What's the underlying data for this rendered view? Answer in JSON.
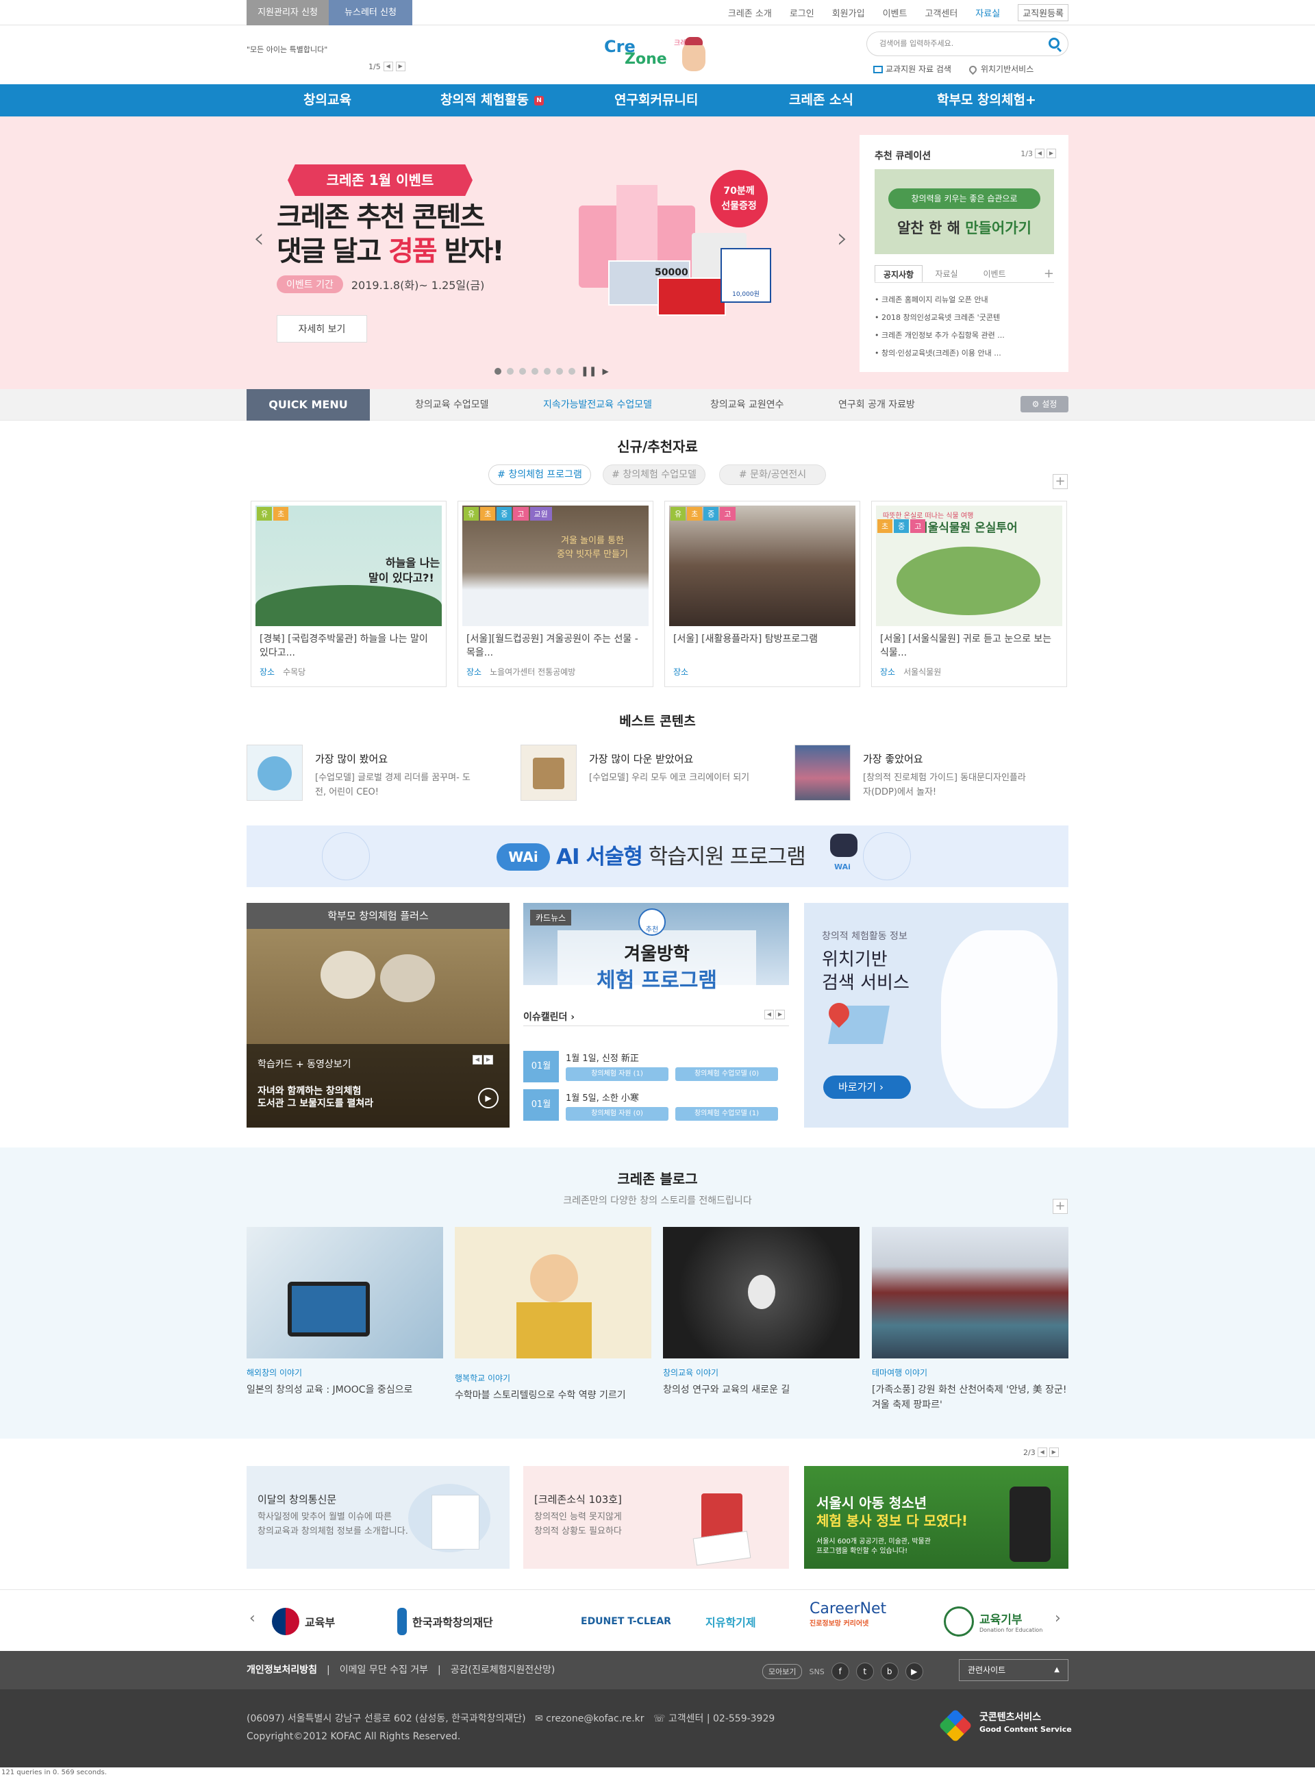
{
  "util": {
    "tab1": "지원관리자 신청",
    "tab2": "뉴스레터 신청",
    "links": [
      "크레존 소개",
      "로그인",
      "회원가입",
      "이벤트",
      "고객센터",
      "자료실",
      "교직원등록"
    ]
  },
  "header": {
    "slogan": "\"모든 아이는 특별합니다\"",
    "slogan_page": "1/5",
    "logo_text_1": "Cre",
    "logo_text_2": "Zone",
    "logo_sub": "크레존",
    "search_placeholder": "검색어를 입력하주세요.",
    "sub_link_1": "교과지원 자료 검색",
    "sub_link_2": "위치기반서비스"
  },
  "gnb": [
    "창의교육",
    "창의적 체험활동",
    "연구회커뮤니티",
    "크레존 소식",
    "학부모 창의체험+"
  ],
  "gnb_new": "N",
  "hero": {
    "badge": "크레존 1월 이벤트",
    "line1": "크레존 추천 콘텐츠",
    "line2a": "댓글 달고 ",
    "line2b": "경품",
    "line2c": " 받자!",
    "period_label": "이벤트 기간",
    "period": "2019.1.8(화)~ 1.25일(금)",
    "more": "자세히 보기",
    "gift_badge": "70분께\n선물증정",
    "card_amount": "50000",
    "card_amount2": "10,000원"
  },
  "curation": {
    "title": "추천 큐레이션",
    "page": "1/3",
    "img_line1": "창의력을 키우는 좋은 습관으로",
    "img_line2a": "알찬 한 해 ",
    "img_line2b": "만들어가기",
    "tabs": [
      "공지사항",
      "자료실",
      "이벤트"
    ],
    "notices": [
      "크레존 홈페이지 리뉴얼 오픈 안내",
      "2018 창의인성교육넷 크레존 '굿콘텐",
      "크레존 개인정보 추가 수집항목 관련 ...",
      "창의·인성교육넷(크레존) 이용 안내 ..."
    ]
  },
  "quick": {
    "label": "QUICK MENU",
    "items": [
      "창의교육 수업모델",
      "지속가능발전교육 수업모델",
      "창의교육 교원연수",
      "연구회 공개 자료방"
    ],
    "settings": "설정"
  },
  "newres": {
    "title": "신규/추천자료",
    "tags": [
      "# 창의체험 프로그램",
      "# 창의체험 수업모델",
      "# 문화/공연전시"
    ],
    "loc_label": "장소",
    "cards": [
      {
        "tags": [
          "유",
          "초"
        ],
        "img_text1": "하늘을 나는",
        "img_text2": "말이 있다고?!",
        "title": "[경북] [국립경주박물관] 하늘을 나는 말이 있다고...",
        "place": "수목당"
      },
      {
        "tags": [
          "유",
          "초",
          "중",
          "고",
          "교원"
        ],
        "img_text1": "겨울 놀이를 통한",
        "img_text2": "중약 빗자루 만들기",
        "title": "[서울][월드컵공원] 겨울공원이 주는 선물 - 목을...",
        "place": "노을여가센터 전통공예방"
      },
      {
        "tags": [
          "유",
          "초",
          "중",
          "고"
        ],
        "title": "[서울] [새활용플라자] 탐방프로그램",
        "place": ""
      },
      {
        "tags": [
          "초",
          "중",
          "고"
        ],
        "img_text1": "따뜻한 온실로 떠나는 식물 여행",
        "img_text2": "서울식물원 온실투어",
        "title": "[서울] [서울식물원] 귀로 듣고 눈으로 보는 식물...",
        "place": "서울식물원"
      }
    ]
  },
  "best": {
    "title": "베스트 콘텐츠",
    "items": [
      {
        "t": "가장 많이 봤어요",
        "d": "[수업모델] 글로벌 경제 리더를 꿈꾸며- 도전, 어린이 CEO!"
      },
      {
        "t": "가장 많이 다운 받았어요",
        "d": "[수업모델] 우리 모두 에코 크리에이터 되기"
      },
      {
        "t": "가장 좋았어요",
        "d": "[창의적 진로체험 가이드] 동대문디자인플라자(DDP)에서 놀자!"
      }
    ]
  },
  "ai": {
    "logo": "WAi",
    "t1": "AI 서술형",
    "t2": " 학습지원 프로그램",
    "robot": "WAi"
  },
  "panel1": {
    "title": "학부모 창의체험 플러스",
    "label": "학습카드 + 동영상보기",
    "cap1": "자녀와 함께하는 창의체험",
    "cap2": "도서관 그 보물지도를 펼쳐라"
  },
  "panel2": {
    "tag": "카드뉴스",
    "badge": "추천",
    "t1": "겨울방학",
    "t2": "체험 프로그램",
    "cal_title": "이슈캘린더",
    "events": [
      {
        "month": "01월",
        "title": "1월 1일, 신정 新正",
        "a": "창의체험 자원 (1)",
        "b": "창의체험 수업모델 (0)"
      },
      {
        "month": "01월",
        "title": "1월 5일, 소한 小寒",
        "a": "창의체험 자원 (0)",
        "b": "창의체험 수업모델 (1)"
      }
    ]
  },
  "panel3": {
    "sub": "창의적 체험활동 정보",
    "t1": "위치기반",
    "t2": "검색 서비스",
    "btn": "바로가기"
  },
  "blog": {
    "title": "크레존 블로그",
    "sub": "크레존만의 다양한 창의 스토리를 전해드립니다",
    "items": [
      {
        "cat": "해외창의 이야기",
        "t": "일본의 창의성 교육 : JMOOC을 중심으로"
      },
      {
        "cat": "행복학교 이야기",
        "t": "수학마블 스토리텔링으로 수학 역량 기르기"
      },
      {
        "cat": "창의교육 이야기",
        "t": "창의성 연구와 교육의 새로운 길"
      },
      {
        "cat": "테마여행 이야기",
        "t": "[가족소풍] 강원 화천 산천어축제 '안녕, 美 장군! 겨울 축제 팡파르'"
      }
    ]
  },
  "banners": {
    "page": "2/3",
    "b1t": "이달의 창의통신문",
    "b1d": "학사일정에 맞추어 월별 이슈에 따른\n창의교육과 창의체험 정보를 소개합니다.",
    "b2t": "[크레존소식 103호]",
    "b2d": "창의적인 능력 못지않게\n창의적 상황도 필요하다",
    "b3a": "서울시 아동 청소년",
    "b3b": "체험 봉사 정보 다 모였다!",
    "b3c": "서울시 600개 공공기관, 미술관, 박물관\n프로그램을 확인할 수 있습니다!"
  },
  "partners": [
    "교육부",
    "한국과학창의재단",
    "EDUNET T-CLEAR",
    "지유학기제",
    "CareerNet",
    "교육기부"
  ],
  "partner_subs": {
    "careernet": "진로정보망 커리어넷",
    "gibu": "Donation for Education"
  },
  "footer": {
    "links": [
      "개인정보처리방침",
      "이메일 무단 수집 거부",
      "공감(진로체험지원전산망)"
    ],
    "sns_more": "모아보기",
    "sns_label": "SNS",
    "family": "관련사이트",
    "address": "(06097) 서울특별시 강남구 선릉로 602 (삼성동, 한국과학창의재단)",
    "email": "crezone@kofac.re.kr",
    "phone": "고객센터 | 02-559-3929",
    "copyright": "Copyright©2012 KOFAC All Rights Reserved.",
    "gcs1": "굿콘텐츠서비스",
    "gcs2": "Good Content Service"
  },
  "debug": "121 queries in 0. 569 seconds."
}
